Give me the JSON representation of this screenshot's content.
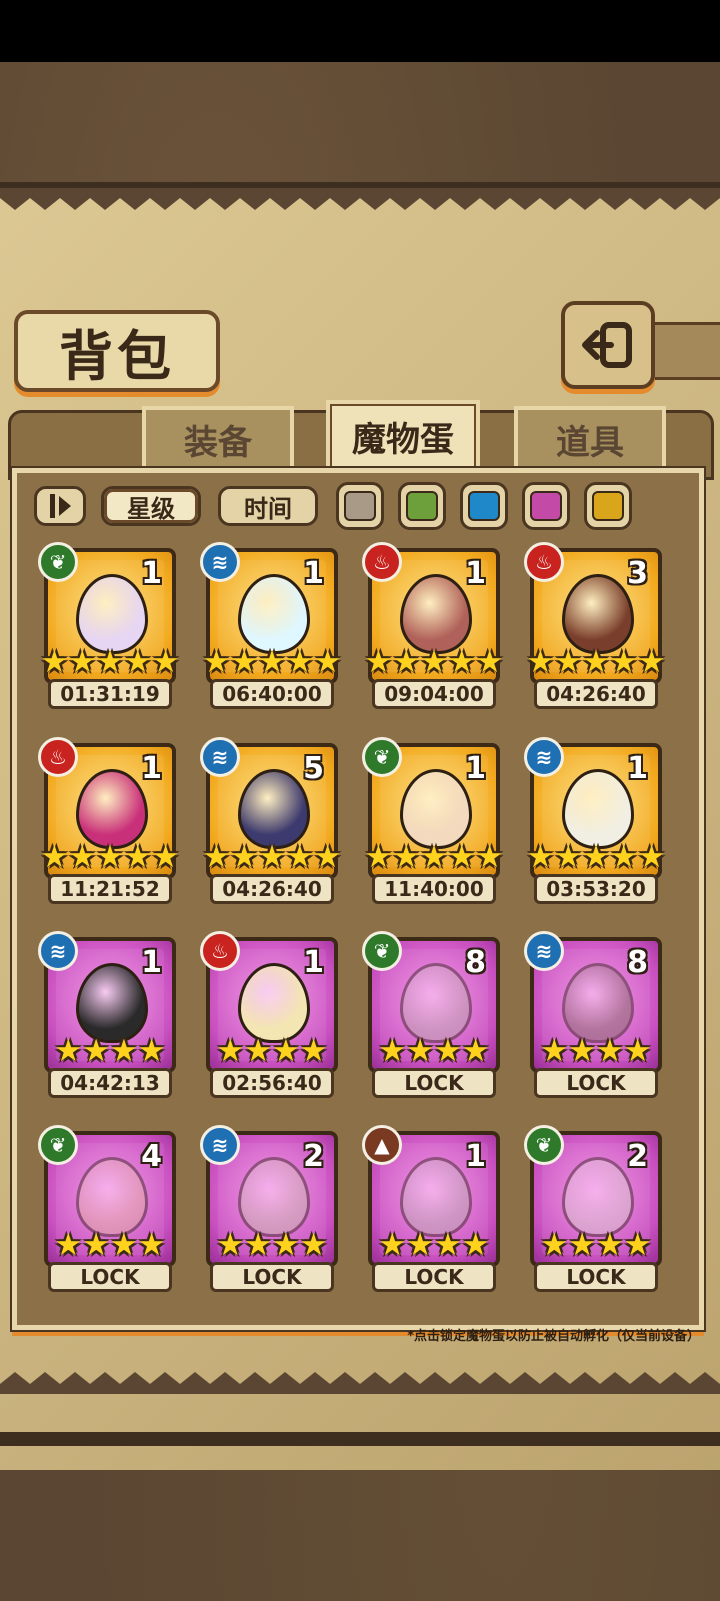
{
  "title": "背包",
  "tabs": [
    {
      "label": "装备",
      "active": false
    },
    {
      "label": "魔物蛋",
      "active": true
    },
    {
      "label": "道具",
      "active": false
    }
  ],
  "filters": {
    "sort_icon": "sort-toggle-icon",
    "star_label": "星级",
    "time_label": "时间",
    "swatches": [
      "#a89a86",
      "#6da03a",
      "#1e88c9",
      "#c44aa8",
      "#d9a51a"
    ]
  },
  "cards": [
    {
      "element": "leaf",
      "count": "1",
      "stars": 5,
      "rarity": "gold",
      "timer": "01:31:19",
      "egg": "#e6d6f3"
    },
    {
      "element": "water",
      "count": "1",
      "stars": 5,
      "rarity": "gold",
      "timer": "06:40:00",
      "egg": "#dff7ff"
    },
    {
      "element": "fire",
      "count": "1",
      "stars": 5,
      "rarity": "gold",
      "timer": "09:04:00",
      "egg": "#b0625a"
    },
    {
      "element": "fire",
      "count": "3",
      "stars": 5,
      "rarity": "gold",
      "timer": "04:26:40",
      "egg": "#7a3f2c"
    },
    {
      "element": "fire",
      "count": "1",
      "stars": 5,
      "rarity": "gold",
      "timer": "11:21:52",
      "egg": "#c9307a"
    },
    {
      "element": "water",
      "count": "5",
      "stars": 5,
      "rarity": "gold",
      "timer": "04:26:40",
      "egg": "#3c3a6e"
    },
    {
      "element": "leaf",
      "count": "1",
      "stars": 5,
      "rarity": "gold",
      "timer": "11:40:00",
      "egg": "#f3d9be"
    },
    {
      "element": "water",
      "count": "1",
      "stars": 5,
      "rarity": "gold",
      "timer": "03:53:20",
      "egg": "#f1efe3"
    },
    {
      "element": "water",
      "count": "1",
      "stars": 4,
      "rarity": "purple",
      "timer": "04:42:13",
      "egg": "#2a2a2a"
    },
    {
      "element": "fire",
      "count": "1",
      "stars": 4,
      "rarity": "purple",
      "timer": "02:56:40",
      "egg": "#f4e6b2"
    },
    {
      "element": "leaf",
      "count": "8",
      "stars": 4,
      "rarity": "purple",
      "timer": "LOCK",
      "egg": "#b8b0a8",
      "faded": true
    },
    {
      "element": "water",
      "count": "8",
      "stars": 4,
      "rarity": "purple",
      "timer": "LOCK",
      "egg": "#7a6e5a",
      "faded": true
    },
    {
      "element": "leaf",
      "count": "4",
      "stars": 4,
      "rarity": "purple",
      "timer": "LOCK",
      "egg": "#e2b69a",
      "faded": true
    },
    {
      "element": "water",
      "count": "2",
      "stars": 4,
      "rarity": "purple",
      "timer": "LOCK",
      "egg": "#c8c4a8",
      "faded": true
    },
    {
      "element": "earth",
      "count": "1",
      "stars": 4,
      "rarity": "purple",
      "timer": "LOCK",
      "egg": "#b8b6ae",
      "faded": true
    },
    {
      "element": "leaf",
      "count": "2",
      "stars": 4,
      "rarity": "purple",
      "timer": "LOCK",
      "egg": "#d9d6cc",
      "faded": true
    }
  ],
  "note": "*点击锁定魔物蛋以防止被自动孵化（仅当前设备）"
}
